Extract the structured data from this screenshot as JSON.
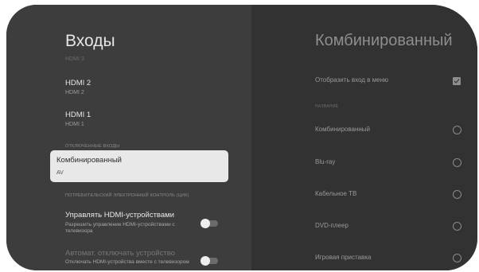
{
  "left": {
    "title": "Входы",
    "clipped_text": "HDMI 3",
    "items": [
      {
        "label": "HDMI 2",
        "sub": "HDMI 2"
      },
      {
        "label": "HDMI 1",
        "sub": "HDMI 1"
      }
    ],
    "section_disconnected": "ОТКЛЮЧЕННЫЕ ВХОДЫ",
    "selected_item": {
      "label": "Комбинированный",
      "sub": "AV"
    },
    "section_cec": "ПОТРЕБИТЕЛЬСКИЙ ЭЛЕКТРОННЫЙ КОНТРОЛЬ (ЦИК)",
    "toggles": [
      {
        "title": "Управлять HDMI-устройствами",
        "desc": "Разрешить управление HDMI-устройствами с телевизора",
        "on": false
      },
      {
        "title": "Автомат. отключать устройство",
        "desc": "Отключать HDMI-устройства вместе с телевизором",
        "on": false
      }
    ]
  },
  "right": {
    "title": "Комбинированный",
    "show_in_menu": "Отобразить вход в меню",
    "show_in_menu_checked": true,
    "section_name": "НАЗВАНИЕ",
    "options": [
      "Комбинированный",
      "Blu-ray",
      "Кабельное ТВ",
      "DVD-плеер",
      "Игровая приставка"
    ]
  },
  "colors": {
    "background": "#3c3c3c",
    "panel_right": "#323232",
    "selected_bg": "#e8e8e8"
  }
}
